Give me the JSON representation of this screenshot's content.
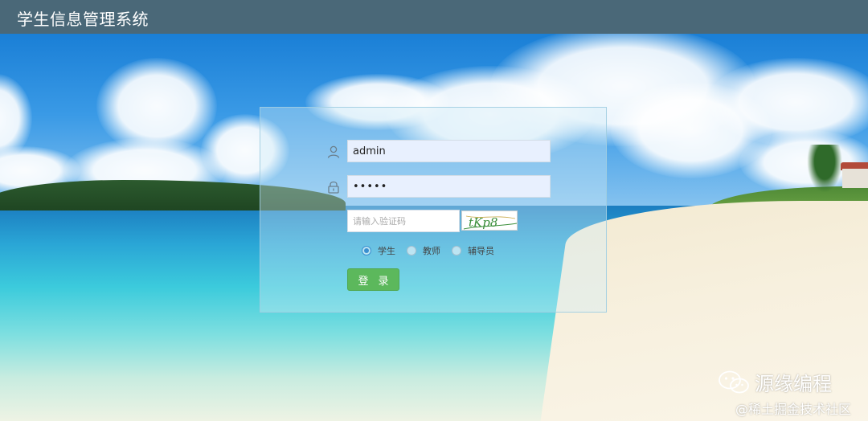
{
  "header": {
    "title": "学生信息管理系统"
  },
  "login": {
    "username_value": "admin",
    "password_value": "•••••",
    "captcha_placeholder": "请输入验证码",
    "captcha_text": "tKp8",
    "roles": [
      {
        "label": "学生",
        "checked": true
      },
      {
        "label": "教师",
        "checked": false
      },
      {
        "label": "辅导员",
        "checked": false
      }
    ],
    "submit_label": "登录"
  },
  "watermark": {
    "main": "源缘编程",
    "sub": "@稀土掘金技术社区"
  },
  "colors": {
    "header_bg": "#4a6878",
    "login_button": "#5cb85c",
    "input_fill": "#e8f0fe",
    "radio_accent": "#3a8fd0"
  },
  "icons": {
    "username": "user-icon",
    "password": "lock-icon",
    "watermark": "wechat-icon"
  }
}
